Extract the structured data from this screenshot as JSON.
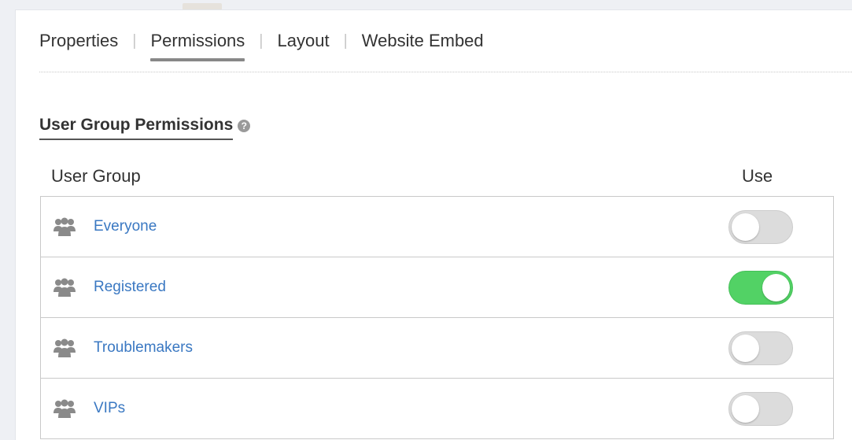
{
  "tabs": [
    {
      "label": "Properties",
      "active": false
    },
    {
      "label": "Permissions",
      "active": true
    },
    {
      "label": "Layout",
      "active": false
    },
    {
      "label": "Website Embed",
      "active": false
    }
  ],
  "section": {
    "title": "User Group Permissions",
    "help_icon": "question-circle-icon",
    "help_glyph": "?"
  },
  "table": {
    "headers": {
      "group": "User Group",
      "use": "Use"
    },
    "rows": [
      {
        "name": "Everyone",
        "use": false
      },
      {
        "name": "Registered",
        "use": true
      },
      {
        "name": "Troublemakers",
        "use": false
      },
      {
        "name": "VIPs",
        "use": false
      }
    ]
  },
  "colors": {
    "link": "#3a78c2",
    "toggle_on": "#52d265",
    "toggle_off": "#dcdcdc",
    "icon": "#8a8a8a"
  }
}
